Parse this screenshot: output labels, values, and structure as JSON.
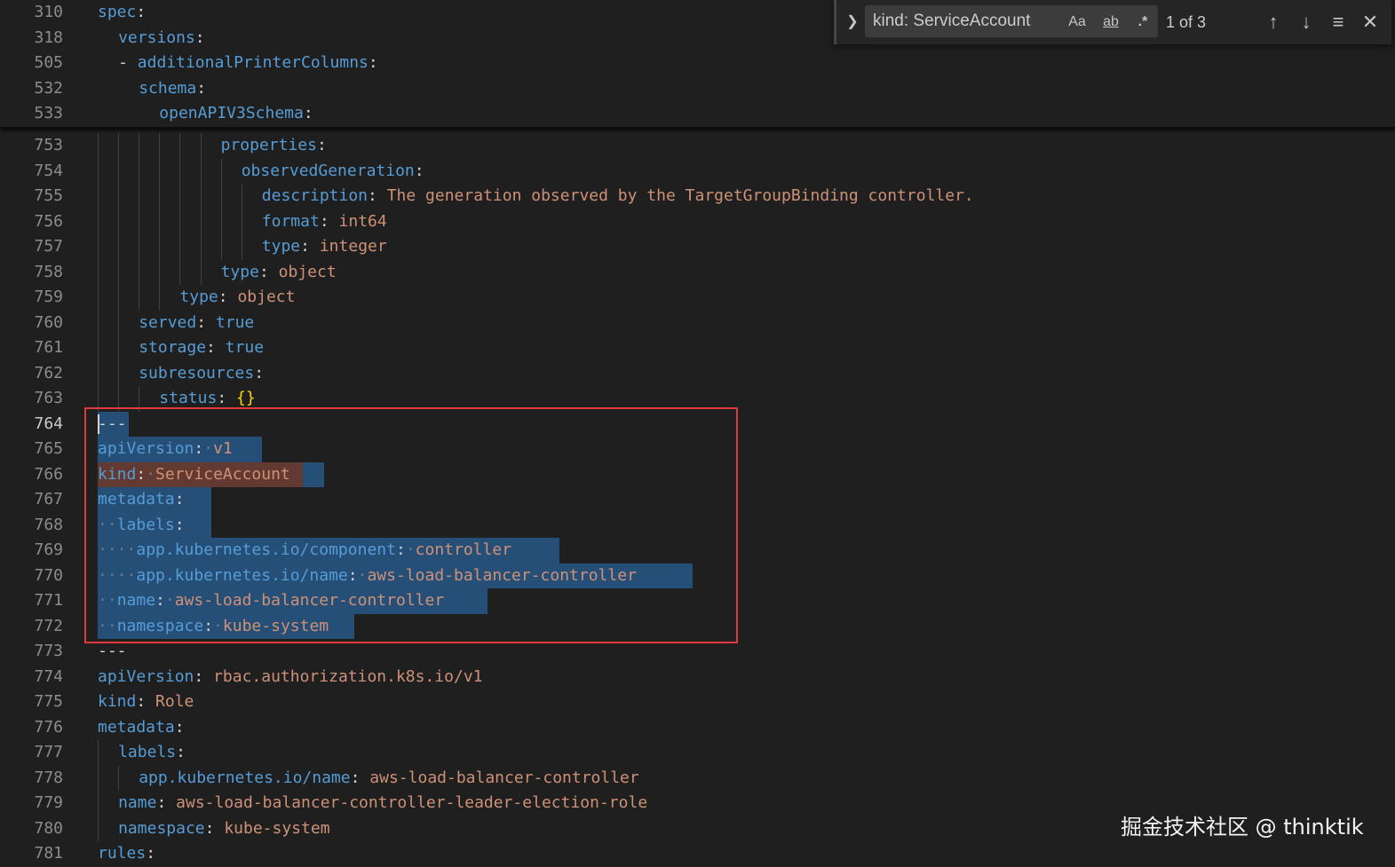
{
  "find_widget": {
    "toggle_icon": "chevron-right-icon",
    "query": "kind: ServiceAccount",
    "match_case_label": "Aa",
    "match_word_label": "ab",
    "regex_label": ".*",
    "match_count": "1 of 3",
    "prev_icon": "arrow-up-icon",
    "next_icon": "arrow-down-icon",
    "selection_icon": "find-in-selection-icon",
    "close_icon": "close-icon"
  },
  "sticky_lines": [
    {
      "num": "310",
      "indent": 0,
      "tokens": [
        [
          "k",
          "spec"
        ],
        [
          "p",
          ":"
        ]
      ]
    },
    {
      "num": "318",
      "indent": 1,
      "tokens": [
        [
          "k",
          "versions"
        ],
        [
          "p",
          ":"
        ]
      ]
    },
    {
      "num": "505",
      "indent": 1,
      "tokens": [
        [
          "p",
          "- "
        ],
        [
          "k",
          "additionalPrinterColumns"
        ],
        [
          "p",
          ":"
        ]
      ]
    },
    {
      "num": "532",
      "indent": 2,
      "tokens": [
        [
          "k",
          "schema"
        ],
        [
          "p",
          ":"
        ]
      ]
    },
    {
      "num": "533",
      "indent": 3,
      "tokens": [
        [
          "k",
          "openAPIV3Schema"
        ],
        [
          "p",
          ":"
        ]
      ]
    }
  ],
  "lines": [
    {
      "num": "753",
      "indent": 6,
      "guides": 6,
      "tokens": [
        [
          "k",
          "properties"
        ],
        [
          "p",
          ":"
        ]
      ]
    },
    {
      "num": "754",
      "indent": 7,
      "guides": 7,
      "tokens": [
        [
          "k",
          "observedGeneration"
        ],
        [
          "p",
          ":"
        ]
      ]
    },
    {
      "num": "755",
      "indent": 8,
      "guides": 8,
      "tokens": [
        [
          "k",
          "description"
        ],
        [
          "p",
          ": "
        ],
        [
          "s",
          "The generation observed by the TargetGroupBinding controller."
        ]
      ]
    },
    {
      "num": "756",
      "indent": 8,
      "guides": 8,
      "tokens": [
        [
          "k",
          "format"
        ],
        [
          "p",
          ": "
        ],
        [
          "s",
          "int64"
        ]
      ]
    },
    {
      "num": "757",
      "indent": 8,
      "guides": 8,
      "tokens": [
        [
          "k",
          "type"
        ],
        [
          "p",
          ": "
        ],
        [
          "s",
          "integer"
        ]
      ]
    },
    {
      "num": "758",
      "indent": 6,
      "guides": 6,
      "tokens": [
        [
          "k",
          "type"
        ],
        [
          "p",
          ": "
        ],
        [
          "s",
          "object"
        ]
      ]
    },
    {
      "num": "759",
      "indent": 4,
      "guides": 4,
      "tokens": [
        [
          "k",
          "type"
        ],
        [
          "p",
          ": "
        ],
        [
          "s",
          "object"
        ]
      ]
    },
    {
      "num": "760",
      "indent": 2,
      "guides": 2,
      "tokens": [
        [
          "k",
          "served"
        ],
        [
          "p",
          ": "
        ],
        [
          "k",
          "true"
        ]
      ]
    },
    {
      "num": "761",
      "indent": 2,
      "guides": 2,
      "tokens": [
        [
          "k",
          "storage"
        ],
        [
          "p",
          ": "
        ],
        [
          "k",
          "true"
        ]
      ]
    },
    {
      "num": "762",
      "indent": 2,
      "guides": 2,
      "tokens": [
        [
          "k",
          "subresources"
        ],
        [
          "p",
          ":"
        ]
      ]
    },
    {
      "num": "763",
      "indent": 3,
      "guides": 3,
      "tokens": [
        [
          "k",
          "status"
        ],
        [
          "p",
          ": "
        ],
        [
          "b",
          "{}"
        ]
      ]
    },
    {
      "num": "764",
      "indent": 0,
      "guides": 0,
      "active": true,
      "caret": true,
      "sel": 2,
      "tokens": [
        [
          "p",
          "---"
        ]
      ]
    },
    {
      "num": "765",
      "indent": 0,
      "guides": 0,
      "sel": 15,
      "tokens": [
        [
          "k",
          "apiVersion"
        ],
        [
          "p",
          ":"
        ],
        [
          "ws",
          "·"
        ],
        [
          "s",
          "v1"
        ]
      ]
    },
    {
      "num": "766",
      "indent": 0,
      "guides": 0,
      "sel": 21,
      "match": 20,
      "tokens": [
        [
          "k",
          "kind"
        ],
        [
          "p",
          ":"
        ],
        [
          "ws",
          "·"
        ],
        [
          "s",
          "ServiceAccount"
        ]
      ]
    },
    {
      "num": "767",
      "indent": 0,
      "guides": 0,
      "sel": 10,
      "tokens": [
        [
          "k",
          "metadata"
        ],
        [
          "p",
          ":"
        ]
      ]
    },
    {
      "num": "768",
      "indent": 0,
      "guides": 0,
      "sel": 10,
      "tokens": [
        [
          "ws",
          "··"
        ],
        [
          "k",
          "labels"
        ],
        [
          "p",
          ":"
        ]
      ]
    },
    {
      "num": "769",
      "indent": 0,
      "guides": 0,
      "sel": 44,
      "tokens": [
        [
          "ws",
          "····"
        ],
        [
          "k",
          "app.kubernetes.io/component"
        ],
        [
          "p",
          ":"
        ],
        [
          "ws",
          "·"
        ],
        [
          "s",
          "controller"
        ]
      ]
    },
    {
      "num": "770",
      "indent": 0,
      "guides": 0,
      "sel": 57,
      "tokens": [
        [
          "ws",
          "····"
        ],
        [
          "k",
          "app.kubernetes.io/name"
        ],
        [
          "p",
          ":"
        ],
        [
          "ws",
          "·"
        ],
        [
          "s",
          "aws-load-balancer-controller"
        ]
      ]
    },
    {
      "num": "771",
      "indent": 0,
      "guides": 0,
      "sel": 37,
      "tokens": [
        [
          "ws",
          "··"
        ],
        [
          "k",
          "name"
        ],
        [
          "p",
          ":"
        ],
        [
          "ws",
          "·"
        ],
        [
          "s",
          "aws-load-balancer-controller"
        ]
      ]
    },
    {
      "num": "772",
      "indent": 0,
      "guides": 0,
      "sel": 24,
      "tokens": [
        [
          "ws",
          "··"
        ],
        [
          "k",
          "namespace"
        ],
        [
          "p",
          ":"
        ],
        [
          "ws",
          "·"
        ],
        [
          "s",
          "kube-system"
        ]
      ]
    },
    {
      "num": "773",
      "indent": 0,
      "guides": 0,
      "tokens": [
        [
          "p",
          "---"
        ]
      ]
    },
    {
      "num": "774",
      "indent": 0,
      "guides": 0,
      "tokens": [
        [
          "k",
          "apiVersion"
        ],
        [
          "p",
          ": "
        ],
        [
          "s",
          "rbac.authorization.k8s.io/v1"
        ]
      ]
    },
    {
      "num": "775",
      "indent": 0,
      "guides": 0,
      "tokens": [
        [
          "k",
          "kind"
        ],
        [
          "p",
          ": "
        ],
        [
          "s",
          "Role"
        ]
      ]
    },
    {
      "num": "776",
      "indent": 0,
      "guides": 0,
      "tokens": [
        [
          "k",
          "metadata"
        ],
        [
          "p",
          ":"
        ]
      ]
    },
    {
      "num": "777",
      "indent": 1,
      "guides": 1,
      "tokens": [
        [
          "k",
          "labels"
        ],
        [
          "p",
          ":"
        ]
      ]
    },
    {
      "num": "778",
      "indent": 2,
      "guides": 2,
      "tokens": [
        [
          "k",
          "app.kubernetes.io/name"
        ],
        [
          "p",
          ": "
        ],
        [
          "s",
          "aws-load-balancer-controller"
        ]
      ]
    },
    {
      "num": "779",
      "indent": 1,
      "guides": 1,
      "tokens": [
        [
          "k",
          "name"
        ],
        [
          "p",
          ": "
        ],
        [
          "s",
          "aws-load-balancer-controller-leader-election-role"
        ]
      ]
    },
    {
      "num": "780",
      "indent": 1,
      "guides": 1,
      "tokens": [
        [
          "k",
          "namespace"
        ],
        [
          "p",
          ": "
        ],
        [
          "s",
          "kube-system"
        ]
      ]
    },
    {
      "num": "781",
      "indent": 0,
      "guides": 0,
      "tokens": [
        [
          "k",
          "rules"
        ],
        [
          "p",
          ":"
        ]
      ]
    }
  ],
  "watermark": "掘金技术社区 @ thinktik"
}
